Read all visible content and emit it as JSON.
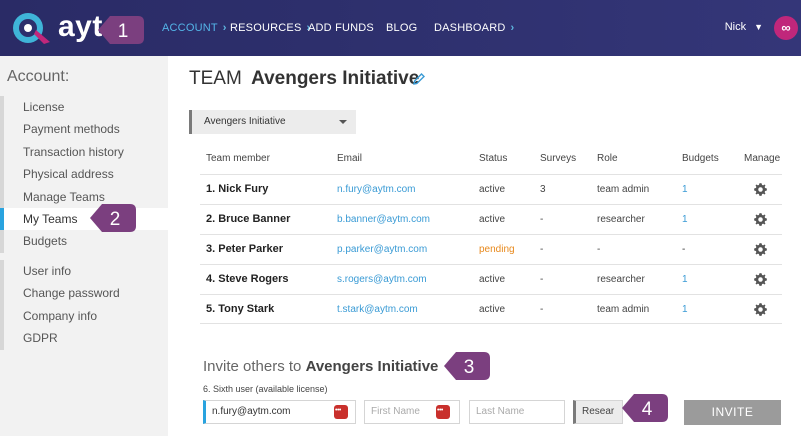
{
  "app": {
    "logo_text": "ayt"
  },
  "nav": {
    "items": [
      {
        "label": "ACCOUNT",
        "chevron": true,
        "active": true
      },
      {
        "label": "RESOURCES",
        "chevron": true,
        "active": false
      },
      {
        "label": "ADD FUNDS",
        "chevron": false,
        "active": false
      },
      {
        "label": "BLOG",
        "chevron": false,
        "active": false
      },
      {
        "label": "DASHBOARD",
        "chevron": true,
        "active": false
      }
    ],
    "user_name": "Nick",
    "avatar_icon": "infinity-icon"
  },
  "sidebar": {
    "title": "Account:",
    "group1": [
      "License",
      "Payment methods",
      "Transaction history",
      "Physical address",
      "Manage Teams",
      "My Teams",
      "Budgets"
    ],
    "group2": [
      "User info",
      "Change password",
      "Company info",
      "GDPR"
    ],
    "active_item": "My Teams"
  },
  "team": {
    "prefix": "TEAM",
    "name": "Avengers Initiative",
    "selected_team": "Avengers Initiative"
  },
  "table": {
    "headers": [
      "Team member",
      "Email",
      "Status",
      "Surveys",
      "Role",
      "Budgets",
      "Manage"
    ],
    "rows": [
      {
        "member": "1. Nick Fury",
        "email": "n.fury@aytm.com",
        "status": "active",
        "surveys": "3",
        "role": "team admin",
        "budgets": "1"
      },
      {
        "member": "2. Bruce Banner",
        "email": "b.banner@aytm.com",
        "status": "active",
        "surveys": "-",
        "role": "researcher",
        "budgets": "1"
      },
      {
        "member": "3. Peter Parker",
        "email": "p.parker@aytm.com",
        "status": "pending",
        "surveys": "-",
        "role": "-",
        "budgets": "-"
      },
      {
        "member": "4. Steve Rogers",
        "email": "s.rogers@aytm.com",
        "status": "active",
        "surveys": "-",
        "role": "researcher",
        "budgets": "1"
      },
      {
        "member": "5. Tony Stark",
        "email": "t.stark@aytm.com",
        "status": "active",
        "surveys": "-",
        "role": "team admin",
        "budgets": "1"
      }
    ]
  },
  "invite": {
    "title_prefix": "Invite others to",
    "team_name": "Avengers Initiative",
    "subtitle": "6. Sixth user (available license)",
    "email_value": "n.fury@aytm.com",
    "first_name_placeholder": "First Name",
    "last_name_placeholder": "Last Name",
    "role_value": "Resear",
    "button_label": "INVITE"
  },
  "callouts": [
    "1",
    "2",
    "3",
    "4"
  ],
  "colors": {
    "accent": "#29a3df",
    "callout": "#7b3f7f",
    "pending": "#e8891c",
    "topbar": "#2d2f6c"
  }
}
